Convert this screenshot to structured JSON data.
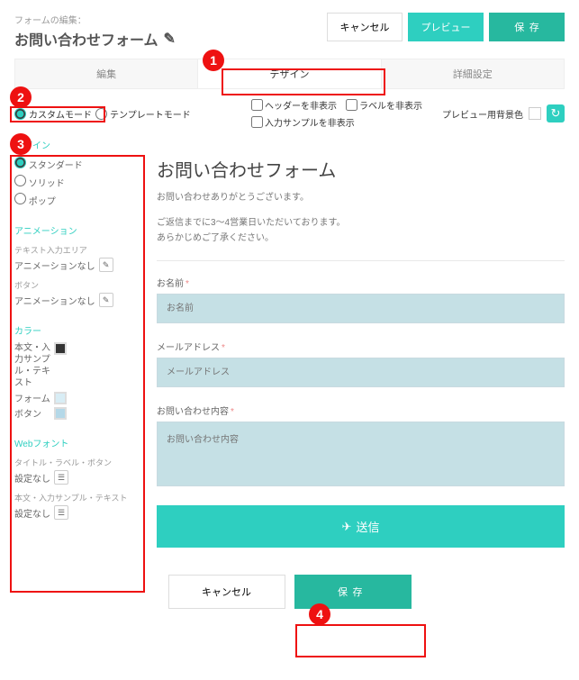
{
  "header": {
    "subtitle": "フォームの編集：",
    "title": "お問い合わせフォーム",
    "cancel": "キャンセル",
    "preview": "プレビュー",
    "save": "保存"
  },
  "tabs": {
    "edit": "編集",
    "design": "デザイン",
    "detail": "詳細設定"
  },
  "options": {
    "mode_custom": "カスタムモード",
    "mode_template": "テンプレートモード",
    "hide_header": "ヘッダーを非表示",
    "hide_label": "ラベルを非表示",
    "hide_sample": "入力サンプルを非表示",
    "bg_label": "プレビュー用背景色"
  },
  "sidebar": {
    "design_title": "デザイン",
    "design_opts": {
      "standard": "スタンダード",
      "solid": "ソリッド",
      "pop": "ポップ"
    },
    "anim_title": "アニメーション",
    "anim_input_label": "テキスト入力エリア",
    "anim_input_value": "アニメーションなし",
    "anim_button_label": "ボタン",
    "anim_button_value": "アニメーションなし",
    "color_title": "カラー",
    "color_body_label": "本文・入力サンプル・テキスト",
    "color_form_label": "フォーム",
    "color_button_label": "ボタン",
    "font_title": "Webフォント",
    "font_title_label": "タイトル・ラベル・ボタン",
    "font_title_value": "設定なし",
    "font_body_label": "本文・入力サンプル・テキスト",
    "font_body_value": "設定なし"
  },
  "preview_form": {
    "title": "お問い合わせフォーム",
    "thanks": "お問い合わせありがとうございます。",
    "note1": "ご返信までに3～4営業日いただいております。",
    "note2": "あらかじめご了承ください。",
    "name_label": "お名前",
    "name_ph": "お名前",
    "email_label": "メールアドレス",
    "email_ph": "メールアドレス",
    "body_label": "お問い合わせ内容",
    "body_ph": "お問い合わせ内容",
    "submit": "送信"
  },
  "footer": {
    "cancel": "キャンセル",
    "save": "保存"
  },
  "callouts": {
    "c1": "1",
    "c2": "2",
    "c3": "3",
    "c4": "4"
  }
}
